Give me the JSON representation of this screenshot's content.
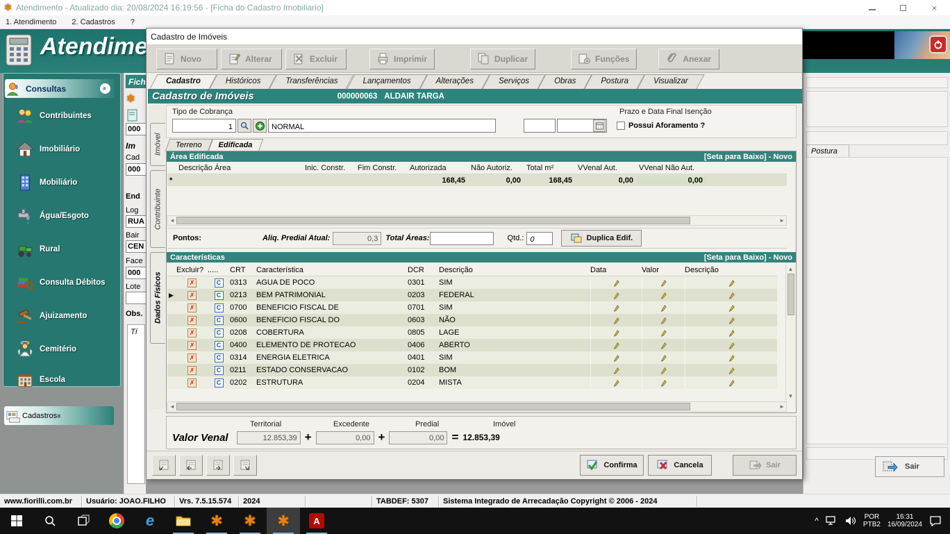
{
  "window": {
    "title": "Atendimento - Atualizado dia: 20/08/2024 16:19:56 - [Ficha do Cadastro Imobiliario]"
  },
  "menu": {
    "items": [
      "1. Atendimento",
      "2. Cadastros",
      "?"
    ]
  },
  "header": {
    "brand": "Atendime"
  },
  "sidebar": {
    "consultas": "Consultas",
    "items": [
      "Contribuintes",
      "Imobiliário",
      "Mobiliário",
      "Água/Esgoto",
      "Rural",
      "Consulta Débitos",
      "Ajuizamento",
      "Cemitério",
      "Escola"
    ],
    "cadastros": "Cadastros"
  },
  "background_form": {
    "ficha_tab": "Fich",
    "postura_tab": "Postura",
    "sair_label": "Sair",
    "fragments": {
      "f1": "000",
      "f2": "Im",
      "f3": "Cad",
      "f4": "000",
      "f5": "End",
      "f6": "Log",
      "f7": "RUA",
      "f8": "Bair",
      "f9": "CEN",
      "f10": "Face",
      "f11": "000",
      "f12": "Lote",
      "f13": "Obs.",
      "f14": "Tí"
    }
  },
  "dialog": {
    "title": "Cadastro de Imóveis",
    "toolbar": [
      "Novo",
      "Alterar",
      "Excluir",
      "Imprimir",
      "Duplicar",
      "Funções",
      "Anexar"
    ],
    "tabs": [
      {
        "label": "Cadastro",
        "active": true
      },
      {
        "label": "Históricos"
      },
      {
        "label": "Transferências"
      },
      {
        "label": "Lançamentos"
      },
      {
        "label": "Alterações"
      },
      {
        "label": "Serviços"
      },
      {
        "label": "Obras"
      },
      {
        "label": "Postura"
      },
      {
        "label": "Visualizar"
      }
    ],
    "record_header": {
      "title": "Cadastro de Imóveis",
      "code": "000000063",
      "owner": "ALDAIR TARGA"
    },
    "vertical_tabs": [
      {
        "label": "Imóvel"
      },
      {
        "label": "Contribuinte"
      },
      {
        "label": "Dados Físicos",
        "active": true
      }
    ],
    "tipo_cobranca": {
      "label": "Tipo de Cobrança",
      "code": "1",
      "description": "NORMAL"
    },
    "isencao_label": "Prazo e Data Final Isenção",
    "aforamento_label": "Possui Aforamento ?",
    "subtabs": [
      {
        "label": "Terreno"
      },
      {
        "label": "Edificada",
        "active": true
      }
    ],
    "area_edificada": {
      "title": "Área Edificada",
      "hint": "[Seta para Baixo] - Novo",
      "columns": [
        "Descrição Área",
        "Inic. Constr.",
        "Fim Constr.",
        "Autorizada",
        "Não Autoriz.",
        "Total m²",
        "VVenal Aut.",
        "VVenal Não Aut."
      ],
      "row": {
        "marker": "*",
        "autorizada": "168,45",
        "nao_autorizada": "0,00",
        "total_m2": "168,45",
        "vvenal_aut": "0,00",
        "vvenal_nao_aut": "0,00"
      }
    },
    "pontos": {
      "label": "Pontos:",
      "aliq_label": "Aliq. Predial Atual:",
      "aliq_value": "0,3",
      "total_areas_label": "Total Áreas:",
      "qtd_label": "Qtd.:",
      "qtd_value": "0",
      "duplica_label": "Duplica Edif."
    },
    "caracteristicas": {
      "title": "Características",
      "hint": "[Seta para Baixo] - Novo",
      "columns": [
        "Excluir?",
        ".....",
        "CRT",
        "Característica",
        "DCR",
        "Descrição",
        "Data",
        "Valor",
        "Descrição"
      ],
      "rows": [
        {
          "marker": "",
          "crt": "0313",
          "nome": "AGUA DE POCO",
          "dcr": "0301",
          "descricao": "SIM"
        },
        {
          "marker": "▶",
          "crt": "0213",
          "nome": "BEM PATRIMONIAL",
          "dcr": "0203",
          "descricao": "FEDERAL"
        },
        {
          "marker": "",
          "crt": "0700",
          "nome": "BENEFICIO FISCAL DE",
          "dcr": "0701",
          "descricao": "SIM"
        },
        {
          "marker": "",
          "crt": "0600",
          "nome": "BENEFICIO FISCAL DO",
          "dcr": "0603",
          "descricao": "NÃO"
        },
        {
          "marker": "",
          "crt": "0208",
          "nome": "COBERTURA",
          "dcr": "0805",
          "descricao": "LAGE"
        },
        {
          "marker": "",
          "crt": "0400",
          "nome": "ELEMENTO DE PROTECAO",
          "dcr": "0406",
          "descricao": "ABERTO"
        },
        {
          "marker": "",
          "crt": "0314",
          "nome": "ENERGIA ELETRICA",
          "dcr": "0401",
          "descricao": "SIM"
        },
        {
          "marker": "",
          "crt": "0211",
          "nome": "ESTADO CONSERVACAO",
          "dcr": "0102",
          "descricao": "BOM"
        },
        {
          "marker": "",
          "crt": "0202",
          "nome": "ESTRUTURA",
          "dcr": "0204",
          "descricao": "MISTA"
        }
      ]
    },
    "valor_venal": {
      "label": "Valor Venal",
      "territorial_label": "Territorial",
      "territorial": "12.853,39",
      "excedente_label": "Excedente",
      "excedente": "0,00",
      "predial_label": "Predial",
      "predial": "0,00",
      "imovel_label": "Imóvel",
      "imovel": "12.853,39",
      "plus": "+",
      "equals": "="
    },
    "actions": {
      "confirma": "Confirma",
      "cancela": "Cancela",
      "sair": "Sair"
    }
  },
  "status_bar": {
    "items": [
      "www.fiorilli.com.br",
      "Usuário: JOAO.FILHO",
      "Vrs. 7.5.15.574",
      "2024",
      "",
      "TABDEF: 5307",
      "Sistema Integrado de Arrecadação Copyright © 2006 - 2024"
    ]
  },
  "taskbar": {
    "tray": {
      "lang_top": "POR",
      "lang_bottom": "PTB2",
      "time": "16:31",
      "date": "16/09/2024"
    }
  }
}
